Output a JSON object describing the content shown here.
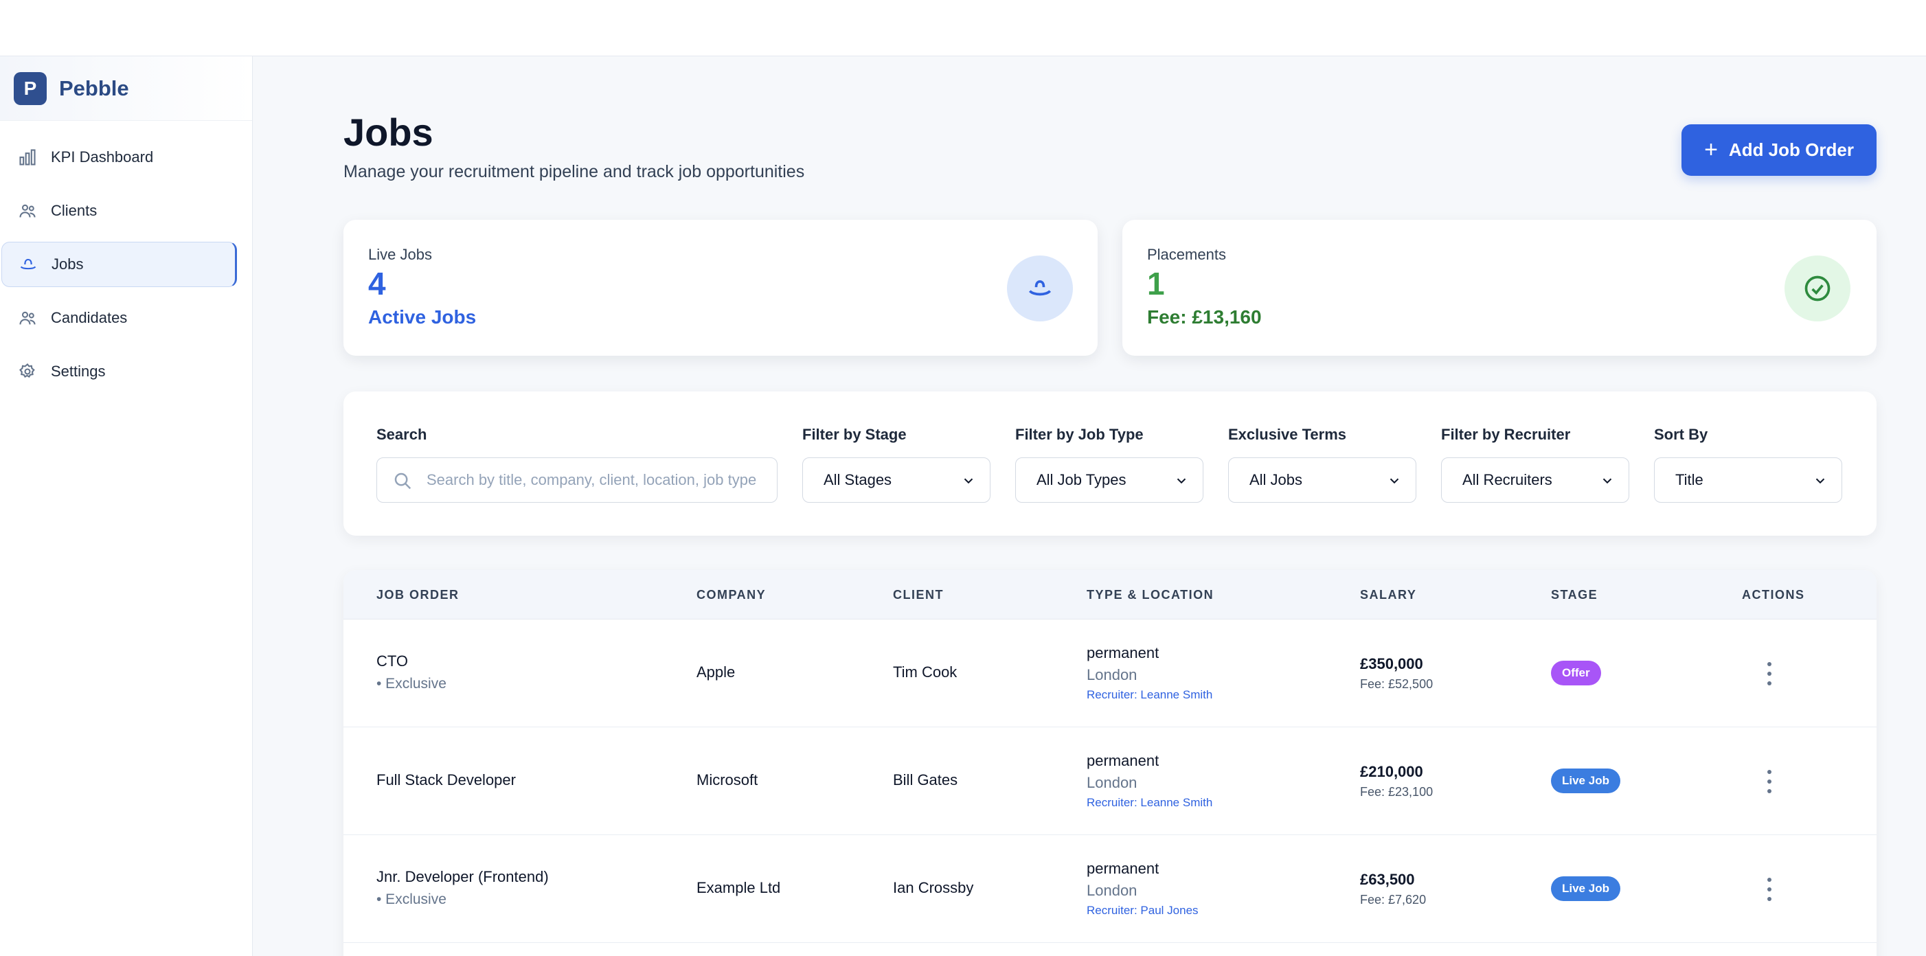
{
  "brand": {
    "logo_letter": "P",
    "name": "Pebble"
  },
  "sidebar": {
    "items": [
      {
        "label": "KPI Dashboard",
        "icon": "bar-chart-icon"
      },
      {
        "label": "Clients",
        "icon": "users-icon"
      },
      {
        "label": "Jobs",
        "icon": "hat-icon",
        "active": true
      },
      {
        "label": "Candidates",
        "icon": "users-icon"
      },
      {
        "label": "Settings",
        "icon": "settings-icon"
      }
    ]
  },
  "header": {
    "title": "Jobs",
    "subtitle": "Manage your recruitment pipeline and track job opportunities",
    "add_button_label": "Add Job Order"
  },
  "stats": {
    "live_jobs": {
      "label": "Live Jobs",
      "value": "4",
      "sub": "Active Jobs"
    },
    "placements": {
      "label": "Placements",
      "value": "1",
      "sub": "Fee: £13,160"
    }
  },
  "filters": {
    "search": {
      "label": "Search",
      "placeholder": "Search by title, company, client, location, job type"
    },
    "stage": {
      "label": "Filter by Stage",
      "value": "All Stages"
    },
    "job_type": {
      "label": "Filter by Job Type",
      "value": "All Job Types"
    },
    "exclusive": {
      "label": "Exclusive Terms",
      "value": "All Jobs"
    },
    "recruiter": {
      "label": "Filter by Recruiter",
      "value": "All Recruiters"
    },
    "sort": {
      "label": "Sort By",
      "value": "Title"
    }
  },
  "table": {
    "headers": {
      "job_order": "JOB ORDER",
      "company": "COMPANY",
      "client": "CLIENT",
      "type_location": "TYPE & LOCATION",
      "salary": "SALARY",
      "stage": "STAGE",
      "actions": "ACTIONS"
    },
    "rows": [
      {
        "title": "CTO",
        "exclusive": "• Exclusive",
        "company": "Apple",
        "client": "Tim Cook",
        "type": "permanent",
        "location": "London",
        "recruiter": "Recruiter: Leanne Smith",
        "salary": "£350,000",
        "fee": "Fee: £52,500",
        "stage": "Offer",
        "stage_color": "#a855f7"
      },
      {
        "title": "Full Stack Developer",
        "exclusive": "",
        "company": "Microsoft",
        "client": "Bill Gates",
        "type": "permanent",
        "location": "London",
        "recruiter": "Recruiter: Leanne Smith",
        "salary": "£210,000",
        "fee": "Fee: £23,100",
        "stage": "Live Job",
        "stage_color": "#3b7de0"
      },
      {
        "title": "Jnr. Developer (Frontend)",
        "exclusive": "• Exclusive",
        "company": "Example Ltd",
        "client": "Ian Crossby",
        "type": "permanent",
        "location": "London",
        "recruiter": "Recruiter: Paul Jones",
        "salary": "£63,500",
        "fee": "Fee: £7,620",
        "stage": "Live Job",
        "stage_color": "#3b7de0"
      }
    ]
  },
  "colors": {
    "accent": "#2f62e0",
    "success": "#3ea04a",
    "offer": "#a855f7",
    "live": "#3b7de0"
  }
}
